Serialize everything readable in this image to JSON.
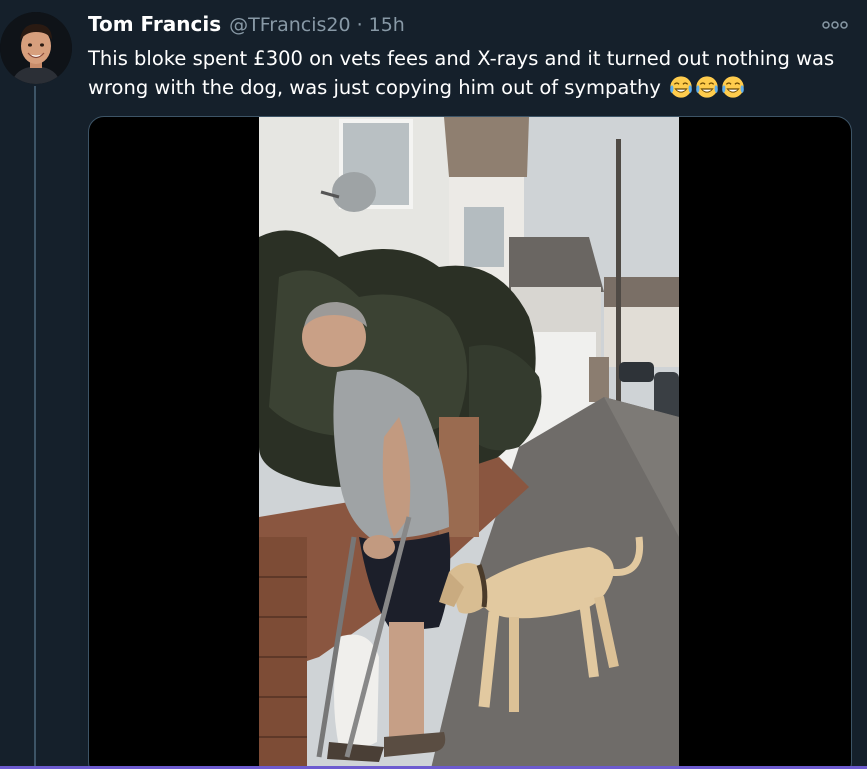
{
  "tweet": {
    "display_name": "Tom Francis",
    "handle": "@TFrancis20",
    "separator": "·",
    "time": "15h",
    "text": "This bloke spent £300 on vets fees and X-rays and it turned out nothing was wrong with the dog, was just copying him out of sympathy",
    "emojis": [
      "face-with-tears-of-joy",
      "face-with-tears-of-joy",
      "face-with-tears-of-joy"
    ]
  },
  "icons": {
    "more": "more-options-icon",
    "emoji": "face-with-tears-of-joy"
  },
  "colors": {
    "background": "#15202b",
    "text_primary": "#ffffff",
    "text_secondary": "#8899a6",
    "border": "#3d5466"
  }
}
